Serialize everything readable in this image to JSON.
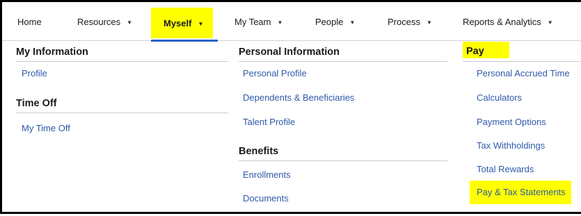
{
  "nav": {
    "items": [
      {
        "label": "Home",
        "has_dropdown": false
      },
      {
        "label": "Resources",
        "has_dropdown": true
      },
      {
        "label": "Myself",
        "has_dropdown": true,
        "active": true
      },
      {
        "label": "My Team",
        "has_dropdown": true
      },
      {
        "label": "People",
        "has_dropdown": true
      },
      {
        "label": "Process",
        "has_dropdown": true
      },
      {
        "label": "Reports & Analytics",
        "has_dropdown": true
      }
    ],
    "caret_glyph": "▼"
  },
  "menu": {
    "col1": {
      "sections": [
        {
          "heading": "My Information",
          "links": [
            "Profile"
          ]
        },
        {
          "heading": "Time Off",
          "links": [
            "My Time Off"
          ]
        }
      ]
    },
    "col2": {
      "sections": [
        {
          "heading": "Personal Information",
          "links": [
            "Personal Profile",
            "Dependents & Beneficiaries",
            "Talent Profile"
          ]
        },
        {
          "heading": "Benefits",
          "links": [
            "Enrollments",
            "Documents"
          ]
        }
      ]
    },
    "col3": {
      "sections": [
        {
          "heading": "Pay",
          "links": [
            "Personal Accrued Time",
            "Calculators",
            "Payment Options",
            "Tax Withholdings",
            "Total Rewards",
            "Pay & Tax Statements"
          ]
        }
      ]
    }
  },
  "colors": {
    "highlight": "#ffff00",
    "link": "#2d5aa8",
    "active_underline": "#2a62c4"
  }
}
